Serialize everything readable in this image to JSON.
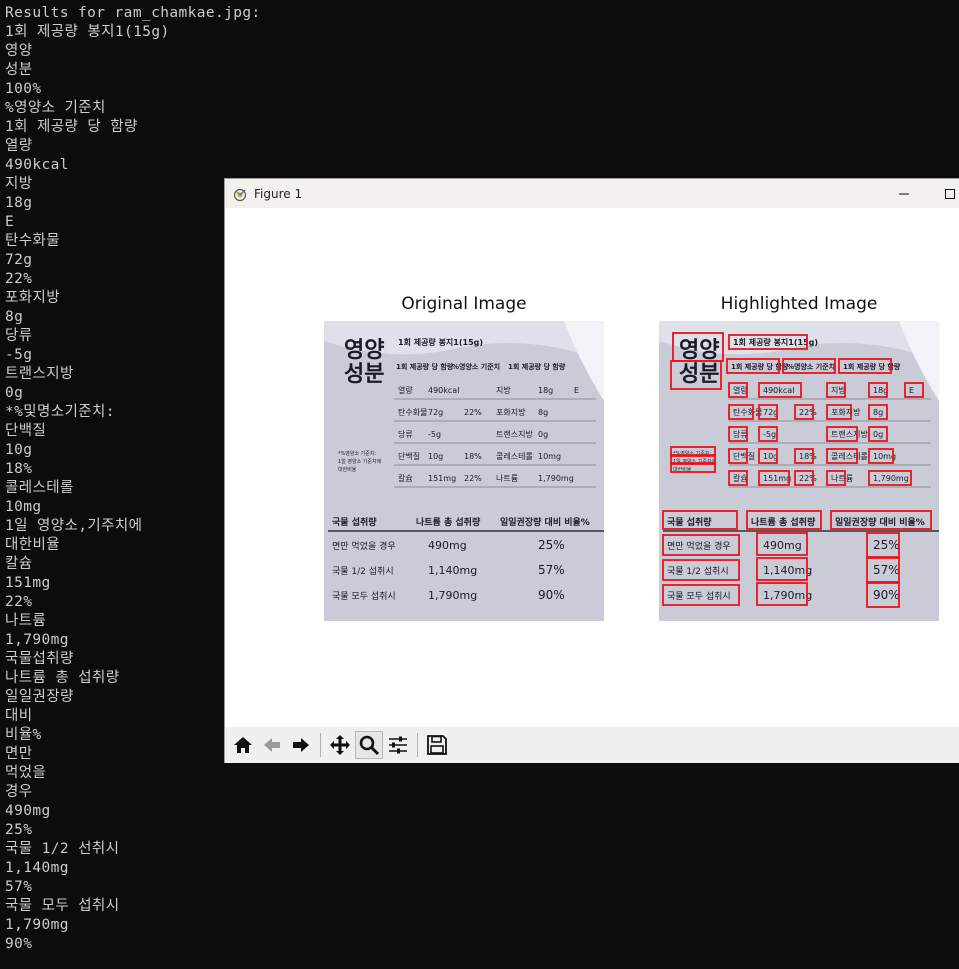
{
  "terminal": {
    "lines": [
      "Results for ram_chamkae.jpg:",
      "1회 제공량 봉지1(15g)",
      "영양",
      "성분",
      "100%",
      "%영양소 기준치",
      "1회 제공량 당 함량",
      "열량",
      "490kcal",
      "지방",
      "18g",
      "E",
      "탄수화물",
      "72g",
      "22%",
      "포화지방",
      "8g",
      "당류",
      "-5g",
      "트랜스지방",
      "0g",
      "*%및명소기준치:",
      "단백질",
      "10g",
      "18%",
      "콜레스테롤",
      "10mg",
      "1일 영양소,기주치에",
      "대한비율",
      "칼슘",
      "151mg",
      "22%",
      "나트륨",
      "1,790mg",
      "국물섭취량",
      "나트륨 총 섭취량",
      "일일권장량",
      "대비",
      "비율%",
      "면만",
      "먹었을",
      "경우",
      "490mg",
      "25%",
      "국물 1/2 선취시",
      "1,140mg",
      "57%",
      "국물 모두 섭취시",
      "1,790mg",
      "90%"
    ]
  },
  "figure": {
    "window_title": "Figure 1",
    "axes": [
      {
        "title": "Original Image"
      },
      {
        "title": "Highlighted Image"
      }
    ],
    "label_image": {
      "headline_left": [
        "영양",
        "성분"
      ],
      "header_row": [
        "1회 제공량 봉지1(15g)"
      ],
      "col_headers": [
        "1회 제공량 당 함량",
        "%영양소 기준치",
        "1회 제공량 당 함량"
      ],
      "rows": [
        [
          "열량",
          "490kcal",
          "",
          "지방",
          "18g",
          "E"
        ],
        [
          "탄수화물",
          "72g",
          "22%",
          "포화지방",
          "8g",
          ""
        ],
        [
          "당류",
          "-5g",
          "",
          "트랜스지방",
          "0g",
          ""
        ],
        [
          "단백질",
          "10g",
          "18%",
          "콜레스테롤",
          "10mg",
          ""
        ],
        [
          "칼슘",
          "151mg",
          "22%",
          "나트륨",
          "1,790mg",
          ""
        ]
      ],
      "side_note": [
        "*%영양소 기준치:",
        "1일 영양소 기준치에",
        "대한비율"
      ],
      "sodium_headers": [
        "국물 섭취량",
        "나트륨 총 섭취량",
        "일일권장량 대비 비율%"
      ],
      "sodium_rows": [
        [
          "면만 먹었을 경우",
          "490mg",
          "25%"
        ],
        [
          "국물 1/2 섭취시",
          "1,140mg",
          "57%"
        ],
        [
          "국물 모두 섭취시",
          "1,790mg",
          "90%"
        ]
      ]
    },
    "toolbar": {
      "buttons": [
        "home-icon",
        "back-icon",
        "forward-icon",
        "pan-icon",
        "zoom-icon",
        "configure-subplots-icon",
        "save-icon"
      ]
    }
  },
  "colors": {
    "terminal_bg": "#0c0c0c",
    "terminal_fg": "#cccccc",
    "highlight_box": "#e8141b"
  }
}
